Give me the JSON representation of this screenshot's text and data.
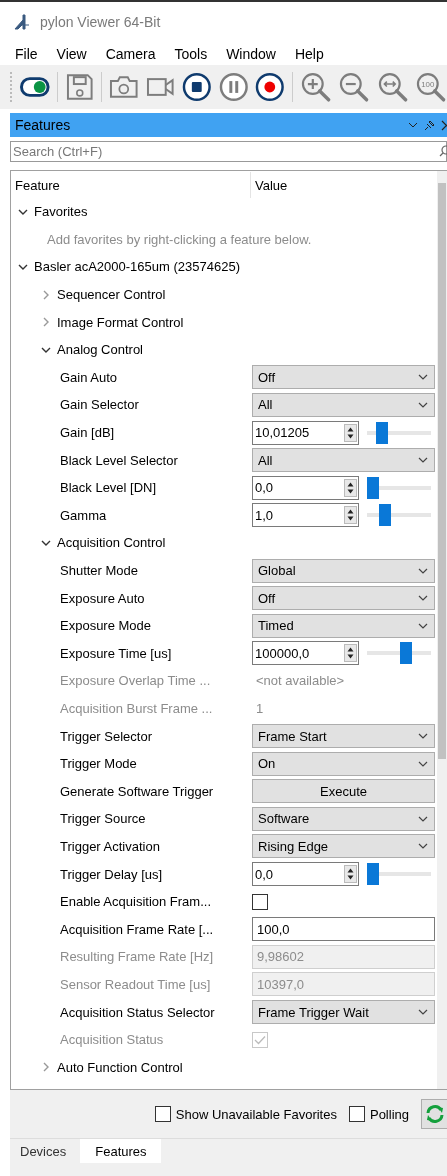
{
  "window": {
    "title": "pylon Viewer 64-Bit"
  },
  "menu": [
    "File",
    "View",
    "Camera",
    "Tools",
    "Window",
    "Help"
  ],
  "toolbar": [
    {
      "kind": "toggle",
      "on": true
    },
    {
      "kind": "separator"
    },
    {
      "kind": "save"
    },
    {
      "kind": "separator"
    },
    {
      "kind": "camera"
    },
    {
      "kind": "video"
    },
    {
      "kind": "stop"
    },
    {
      "kind": "pause"
    },
    {
      "kind": "record"
    },
    {
      "kind": "separator"
    },
    {
      "kind": "zoom-in"
    },
    {
      "kind": "zoom-out"
    },
    {
      "kind": "zoom-fit"
    },
    {
      "kind": "zoom-100",
      "label": "100"
    }
  ],
  "panel": {
    "title": "Features",
    "search": {
      "placeholder": "Search (Ctrl+F)"
    },
    "columns": [
      "Feature",
      "Value"
    ],
    "tree": [
      {
        "label": "Favorites",
        "kind": "group",
        "expanded": true,
        "children": [
          {
            "label": "Add favorites by right-clicking a feature below.",
            "kind": "hint"
          }
        ]
      },
      {
        "label": "Basler acA2000-165um (23574625)",
        "kind": "group",
        "expanded": true,
        "children": [
          {
            "label": "Sequencer Control",
            "kind": "group",
            "expanded": false
          },
          {
            "label": "Image Format Control",
            "kind": "group",
            "expanded": false
          },
          {
            "label": "Analog Control",
            "kind": "group",
            "expanded": true,
            "children": [
              {
                "label": "Gain Auto",
                "kind": "enum",
                "value": "Off",
                "disabled": false
              },
              {
                "label": "Gain Selector",
                "kind": "enum",
                "value": "All",
                "disabled": false
              },
              {
                "label": "Gain [dB]",
                "kind": "number",
                "value": "10,01205",
                "level": 0.17,
                "disabled": false
              },
              {
                "label": "Black Level Selector",
                "kind": "enum",
                "value": "All",
                "disabled": false
              },
              {
                "label": "Black Level [DN]",
                "kind": "number",
                "value": "0,0",
                "level": 0,
                "disabled": false
              },
              {
                "label": "Gamma",
                "kind": "number",
                "value": "1,0",
                "level": 0.24,
                "disabled": false
              }
            ]
          },
          {
            "label": "Acquisition Control",
            "kind": "group",
            "expanded": true,
            "children": [
              {
                "label": "Shutter Mode",
                "kind": "enum",
                "value": "Global",
                "disabled": false
              },
              {
                "label": "Exposure Auto",
                "kind": "enum",
                "value": "Off",
                "disabled": false
              },
              {
                "label": "Exposure Mode",
                "kind": "enum",
                "value": "Timed",
                "disabled": false
              },
              {
                "label": "Exposure Time [us]",
                "kind": "number",
                "value": "100000,0",
                "level": 0.63,
                "disabled": false
              },
              {
                "label": "Exposure Overlap Time ...",
                "kind": "text",
                "value": "<not available>",
                "disabled": true
              },
              {
                "label": "Acquisition Burst Frame ...",
                "kind": "text",
                "value": "1",
                "disabled": true
              },
              {
                "label": "Trigger Selector",
                "kind": "enum",
                "value": "Frame Start",
                "disabled": false
              },
              {
                "label": "Trigger Mode",
                "kind": "enum",
                "value": "On",
                "disabled": false
              },
              {
                "label": "Generate Software Trigger",
                "kind": "button",
                "value": "Execute",
                "disabled": false
              },
              {
                "label": "Trigger Source",
                "kind": "enum",
                "value": "Software",
                "disabled": false
              },
              {
                "label": "Trigger Activation",
                "kind": "enum",
                "value": "Rising Edge",
                "disabled": false
              },
              {
                "label": "Trigger Delay [us]",
                "kind": "number",
                "value": "0,0",
                "level": 0,
                "disabled": false
              },
              {
                "label": "Enable Acquisition Fram...",
                "kind": "checkbox",
                "checked": false,
                "disabled": false
              },
              {
                "label": "Acquisition Frame Rate [...",
                "kind": "field",
                "value": "100,0",
                "disabled": false
              },
              {
                "label": "Resulting Frame Rate [Hz]",
                "kind": "field",
                "value": "9,98602",
                "disabled": true
              },
              {
                "label": "Sensor Readout Time [us]",
                "kind": "field",
                "value": "10397,0",
                "disabled": true
              },
              {
                "label": "Acquisition Status Selector",
                "kind": "enum",
                "value": "Frame Trigger Wait",
                "disabled": false
              },
              {
                "label": "Acquisition Status",
                "kind": "checkbox",
                "checked": true,
                "disabled": true
              }
            ]
          },
          {
            "label": "Auto Function Control",
            "kind": "group",
            "expanded": false
          }
        ]
      }
    ],
    "footer": [
      {
        "label": "Show Unavailable Favorites",
        "checked": false
      },
      {
        "label": "Polling",
        "checked": false
      }
    ]
  },
  "tabs": [
    {
      "label": "Devices",
      "selected": false
    },
    {
      "label": "Features",
      "selected": true
    }
  ]
}
